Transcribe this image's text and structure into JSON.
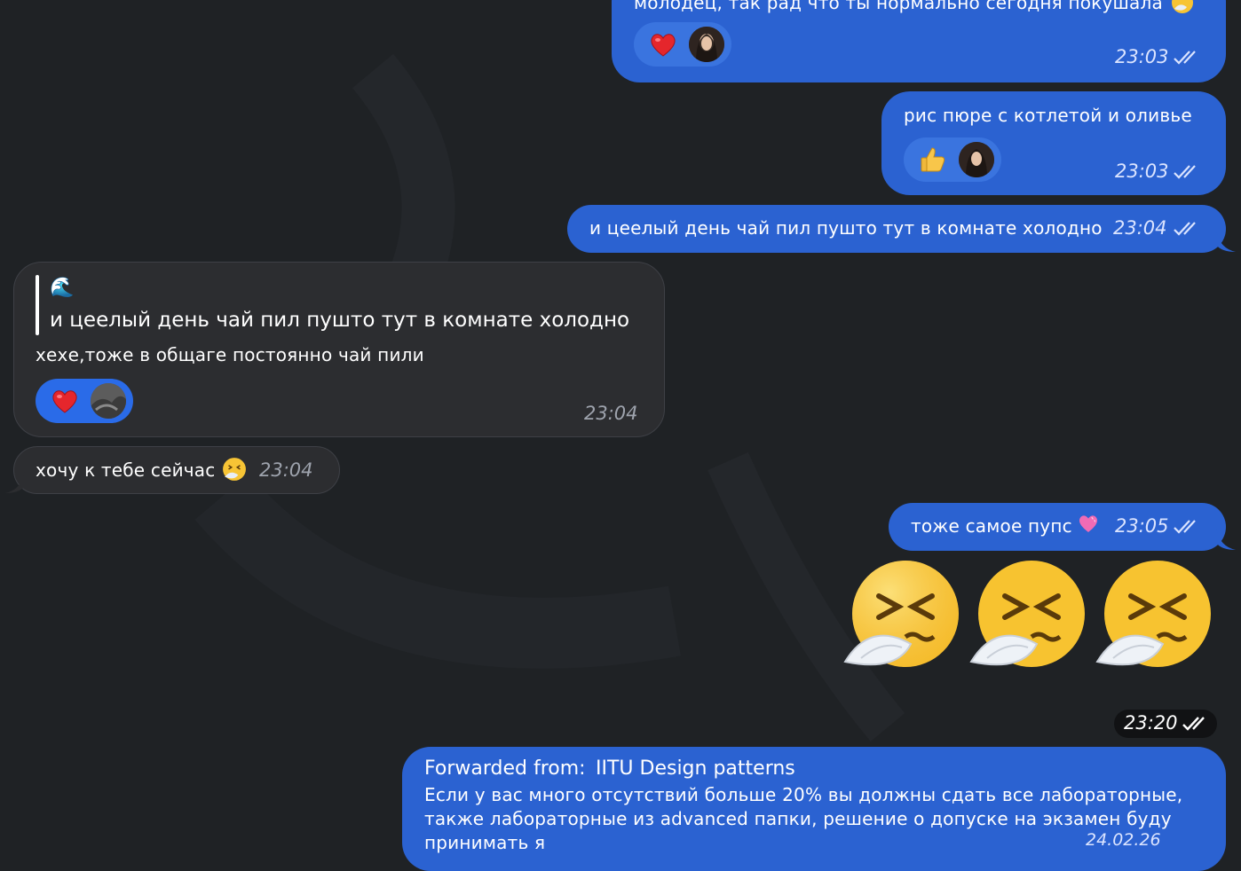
{
  "chat": {
    "messages": [
      {
        "text": "молодец, так рад что ты нормально сегодня покушала",
        "time": "23:03",
        "reaction": "heart"
      },
      {
        "text": "рис пюре с котлетой и оливье",
        "time": "23:03",
        "reaction": "thumbs-up"
      },
      {
        "text": "и цеелый день чай пил пушто тут в комнате холодно",
        "time": "23:04"
      },
      {
        "quote_emoji": "🌊",
        "quote_text": "и цеелый день чай пил пушто тут в комнате холодно",
        "text": "хехе,тоже в общаге постоянно чай пили",
        "time": "23:04",
        "reaction": "heart"
      },
      {
        "text": "хочу к тебе сейчас",
        "time": "23:04"
      },
      {
        "text": "тоже самое пупс",
        "time": "23:05"
      },
      {
        "time": "23:20",
        "emoji_count": 3
      },
      {
        "forwarded_label": "Forwarded from:",
        "forwarded_source": "IITU Design patterns",
        "text_line1": "Если у вас много отсутствий больше 20% вы должны сдать все лабораторные,",
        "text_line2": "также лабораторные из advanced папки, решение о допуске на экзамен буду",
        "text_line3": "принимать я",
        "time": "24.02.26"
      }
    ]
  },
  "colors": {
    "background": "#1f2225",
    "outgoing_bubble": "#2b62d1",
    "incoming_bubble": "#2c2d30",
    "time_pill": "#111214"
  }
}
